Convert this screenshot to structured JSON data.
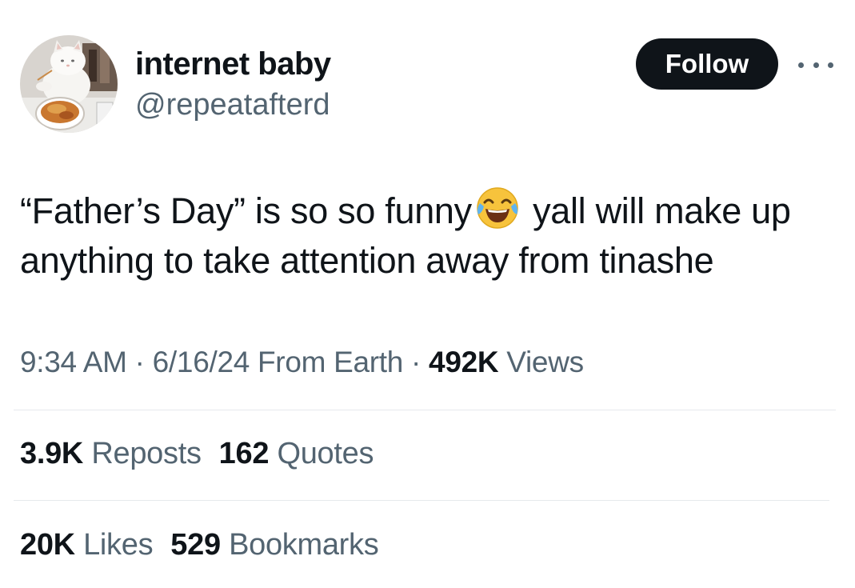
{
  "user": {
    "display_name": "internet baby",
    "handle": "@repeatafterd"
  },
  "follow_label": "Follow",
  "more_icon": "more-horizontal-icon",
  "tweet": {
    "text_part1": "“Father’s Day” is so so funny",
    "emoji": "face-with-tears-of-joy",
    "text_part2": "yall will make up anything to take attention away from tinashe"
  },
  "meta": {
    "time": "9:34 AM",
    "separator": "·",
    "date": "6/16/24",
    "source": "From Earth",
    "views_count": "492K",
    "views_label": "Views"
  },
  "stats": {
    "reposts_count": "3.9K",
    "reposts_label": "Reposts",
    "quotes_count": "162",
    "quotes_label": "Quotes",
    "likes_count": "20K",
    "likes_label": "Likes",
    "bookmarks_count": "529",
    "bookmarks_label": "Bookmarks"
  },
  "colors": {
    "text_primary": "#0f1419",
    "text_secondary": "#536471",
    "button_bg": "#0f1419",
    "divider": "#e6e9ec"
  }
}
